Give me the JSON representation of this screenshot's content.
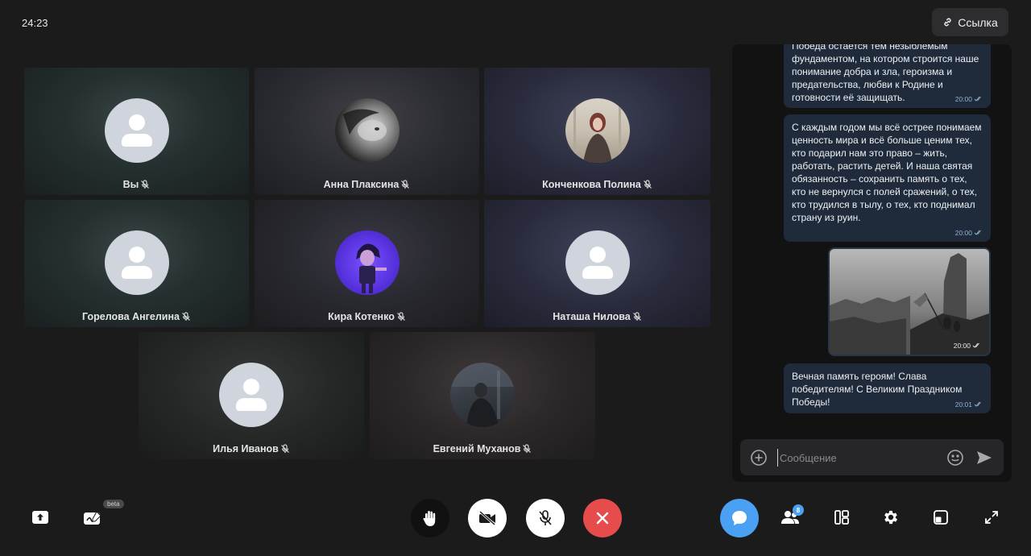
{
  "header": {
    "timer": "24:23",
    "link_label": "Ссылка"
  },
  "participants": [
    {
      "name": "Вы",
      "avatar": "default"
    },
    {
      "name": "Анна Плаксина",
      "avatar": "photo-bw-portrait"
    },
    {
      "name": "Конченкова Полина",
      "avatar": "photo-girl"
    },
    {
      "name": "Горелова Ангелина",
      "avatar": "default"
    },
    {
      "name": "Кира Котенко",
      "avatar": "photo-purple-character"
    },
    {
      "name": "Наташа Нилова",
      "avatar": "default"
    },
    {
      "name": "Илья Иванов",
      "avatar": "default"
    },
    {
      "name": "Евгений Муханов",
      "avatar": "photo-dark"
    }
  ],
  "chat": {
    "messages": [
      {
        "text": "Победа остается тем незыблемым фундаментом, на котором строится наше понимание добра и зла, героизма и предательства, любви к Родине и готовности её защищать.",
        "time": "20:00"
      },
      {
        "text": "С каждым годом мы всё острее понимаем ценность мира и всё больше ценим тех, кто подарил нам это право – жить, работать, растить детей. И наша святая обязанность – сохранить память о тех, кто не вернулся с полей сражений, о тех, кто трудился в тылу, о тех, кто поднимал страну из руин.",
        "time": "20:00"
      },
      {
        "type": "photo",
        "time": "20:00"
      },
      {
        "text": "Вечная память героям! Слава победителям! С Великим Праздником Победы!",
        "time": "20:01"
      }
    ],
    "input_placeholder": "Сообщение"
  },
  "toolbar": {
    "beta_label": "beta",
    "participants_count": "8",
    "icons": [
      "share-screen-icon",
      "whiteboard-icon",
      "raise-hand-icon",
      "camera-off-icon",
      "mic-off-icon",
      "hang-up-icon",
      "chat-icon",
      "participants-icon",
      "layout-icon",
      "settings-icon",
      "picture-in-picture-icon",
      "fullscreen-icon"
    ],
    "colors": {
      "chat_active": "#4aa1f3",
      "hangup": "#e74c4c",
      "white_button": "#ffffff"
    }
  }
}
